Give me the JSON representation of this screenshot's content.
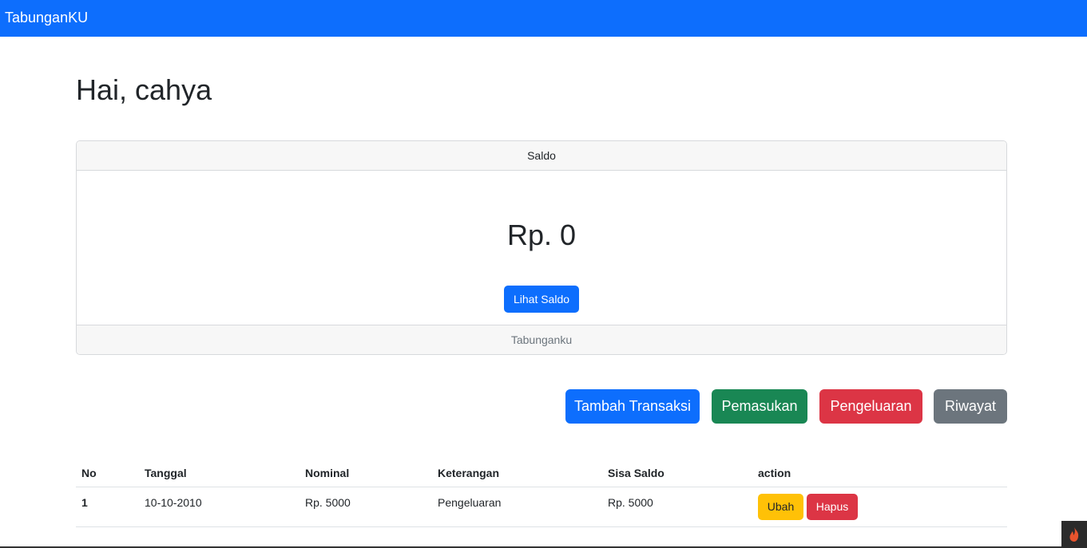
{
  "navbar": {
    "brand": "TabunganKU"
  },
  "greeting": "Hai, cahya",
  "card": {
    "header": "Saldo",
    "amount": "Rp. 0",
    "button": "Lihat Saldo",
    "footer": "Tabunganku"
  },
  "actions": {
    "tambah": "Tambah Transaksi",
    "pemasukan": "Pemasukan",
    "pengeluaran": "Pengeluaran",
    "riwayat": "Riwayat"
  },
  "table": {
    "headers": [
      "No",
      "Tanggal",
      "Nominal",
      "Keterangan",
      "Sisa Saldo",
      "action"
    ],
    "rows": [
      {
        "no": "1",
        "tanggal": "10-10-2010",
        "nominal": "Rp. 5000",
        "keterangan": "Pengeluaran",
        "sisa": "Rp. 5000",
        "edit": "Ubah",
        "delete": "Hapus"
      }
    ]
  },
  "colors": {
    "primary": "#0d6efd",
    "success": "#198754",
    "danger": "#dc3545",
    "secondary": "#6c757d",
    "warning": "#ffc107"
  },
  "icons": {
    "corner": "flame-icon"
  }
}
